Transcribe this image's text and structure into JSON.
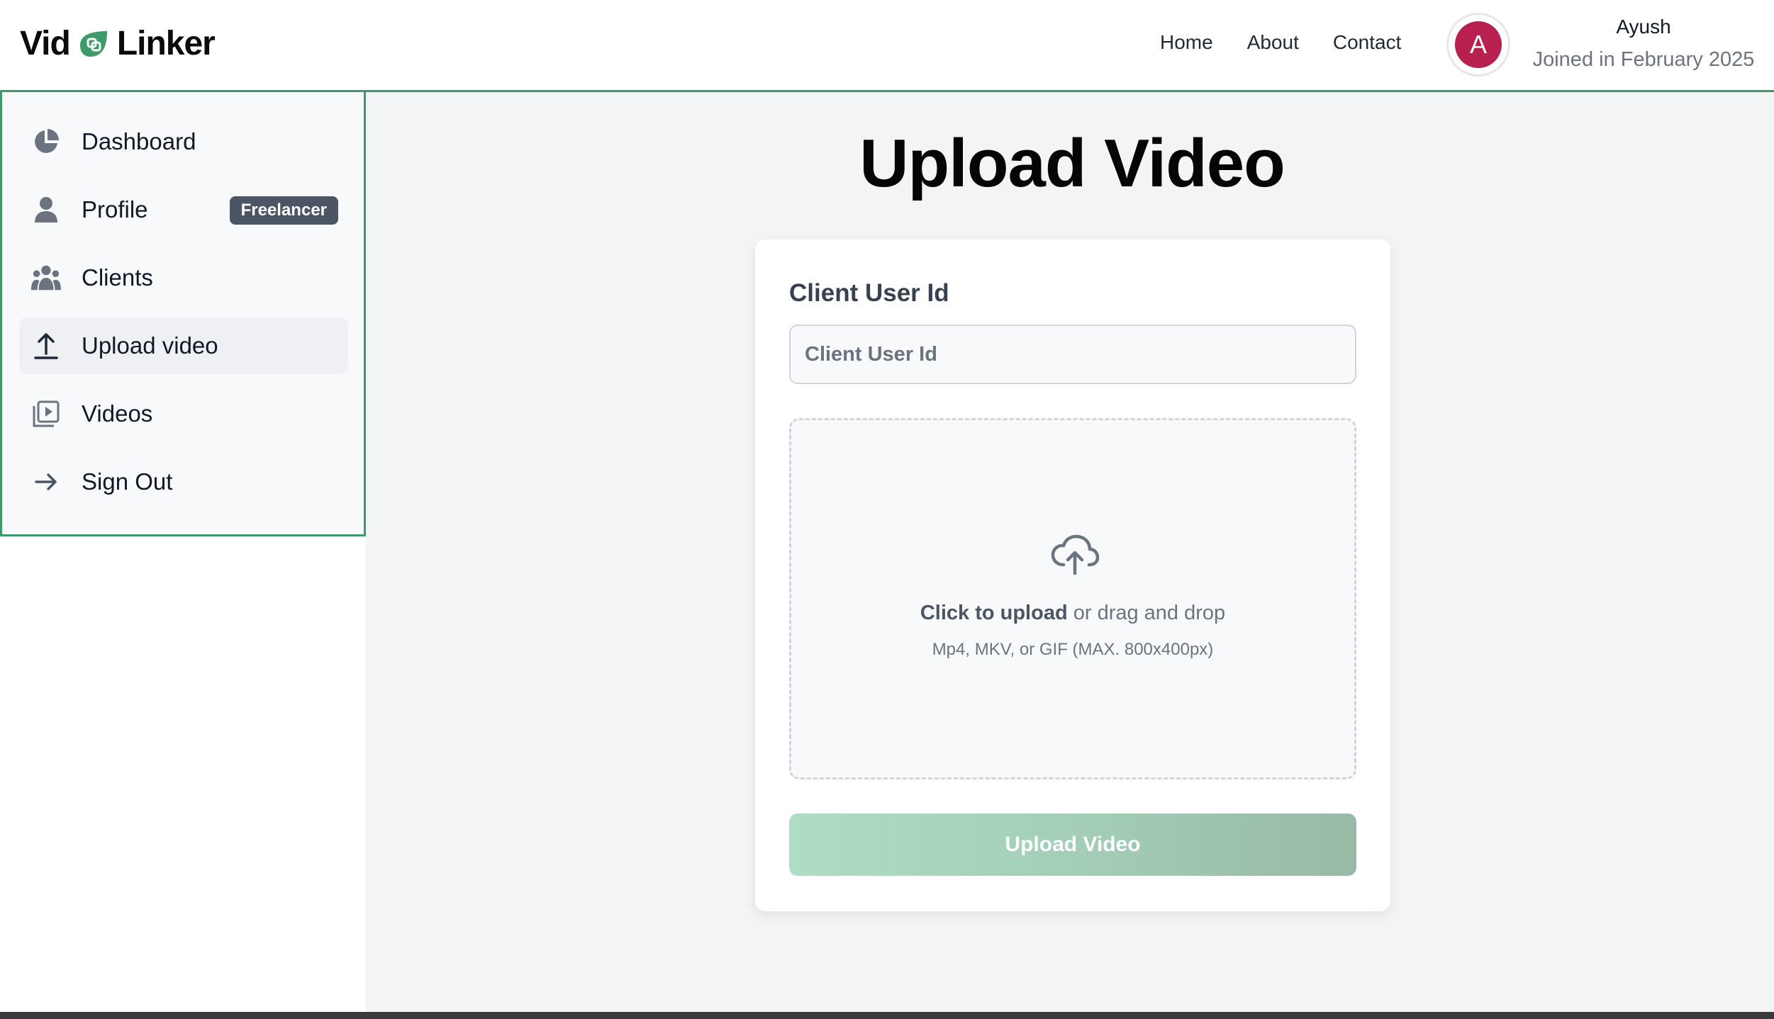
{
  "header": {
    "logo_left": "Vid",
    "logo_right": "Linker",
    "nav": [
      "Home",
      "About",
      "Contact"
    ],
    "avatar_initial": "A",
    "user_name": "Ayush",
    "user_joined": "Joined in February 2025"
  },
  "sidebar": {
    "items": [
      {
        "label": "Dashboard",
        "icon": "pie-chart-icon"
      },
      {
        "label": "Profile",
        "icon": "user-icon",
        "badge": "Freelancer"
      },
      {
        "label": "Clients",
        "icon": "users-icon"
      },
      {
        "label": "Upload video",
        "icon": "upload-icon",
        "active": true
      },
      {
        "label": "Videos",
        "icon": "video-library-icon"
      },
      {
        "label": "Sign Out",
        "icon": "arrow-right-icon"
      }
    ]
  },
  "main": {
    "title": "Upload Video",
    "form": {
      "client_label": "Client User Id",
      "client_placeholder": "Client User Id",
      "client_value": "",
      "drop_strong": "Click to upload",
      "drop_rest": " or drag and drop",
      "drop_hint": "Mp4, MKV, or GIF (MAX. 800x400px)",
      "submit_label": "Upload Video"
    }
  },
  "colors": {
    "accent": "#3f9a6b",
    "avatar": "#b8204f",
    "badge": "#4b5563",
    "button_start": "#aedcc4",
    "button_end": "#98b9a6"
  }
}
